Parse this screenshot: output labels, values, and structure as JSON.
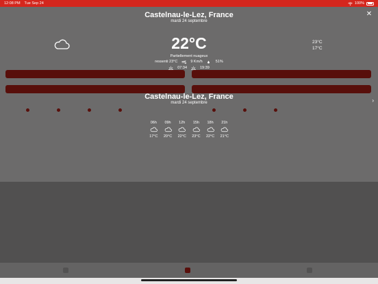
{
  "status_bar": {
    "time": "12:08 PM",
    "date": "Tue Sep 24",
    "battery": "100%"
  },
  "current": {
    "location": "Castelnau-le-Lez, France",
    "date": "mardi 24 septembre",
    "icon": "cloud-icon",
    "temperature": "22°C",
    "max": "23°C",
    "min": "17°C",
    "condition": "Partiellement nuageux",
    "feels_like": "ressenti 23°C",
    "wind": "9 Km/h",
    "humidity": "51%",
    "sunrise": "07:34",
    "sunset": "19:39"
  },
  "forecast": {
    "location": "Castelnau-le-Lez, France",
    "date": "mardi 24 septembre",
    "hours": [
      {
        "hour": "06h",
        "icon": "cloud-icon",
        "temp": "17°C"
      },
      {
        "hour": "09h",
        "icon": "cloud-icon",
        "temp": "20°C"
      },
      {
        "hour": "12h",
        "icon": "cloud-icon",
        "temp": "22°C"
      },
      {
        "hour": "15h",
        "icon": "cloud-icon",
        "temp": "23°C"
      },
      {
        "hour": "18h",
        "icon": "cloud-icon",
        "temp": "22°C"
      },
      {
        "hour": "21h",
        "icon": "cloud-icon",
        "temp": "21°C"
      }
    ]
  },
  "colors": {
    "accent": "#d4261d",
    "overlay": "rgba(0,0,0,0.56)"
  }
}
